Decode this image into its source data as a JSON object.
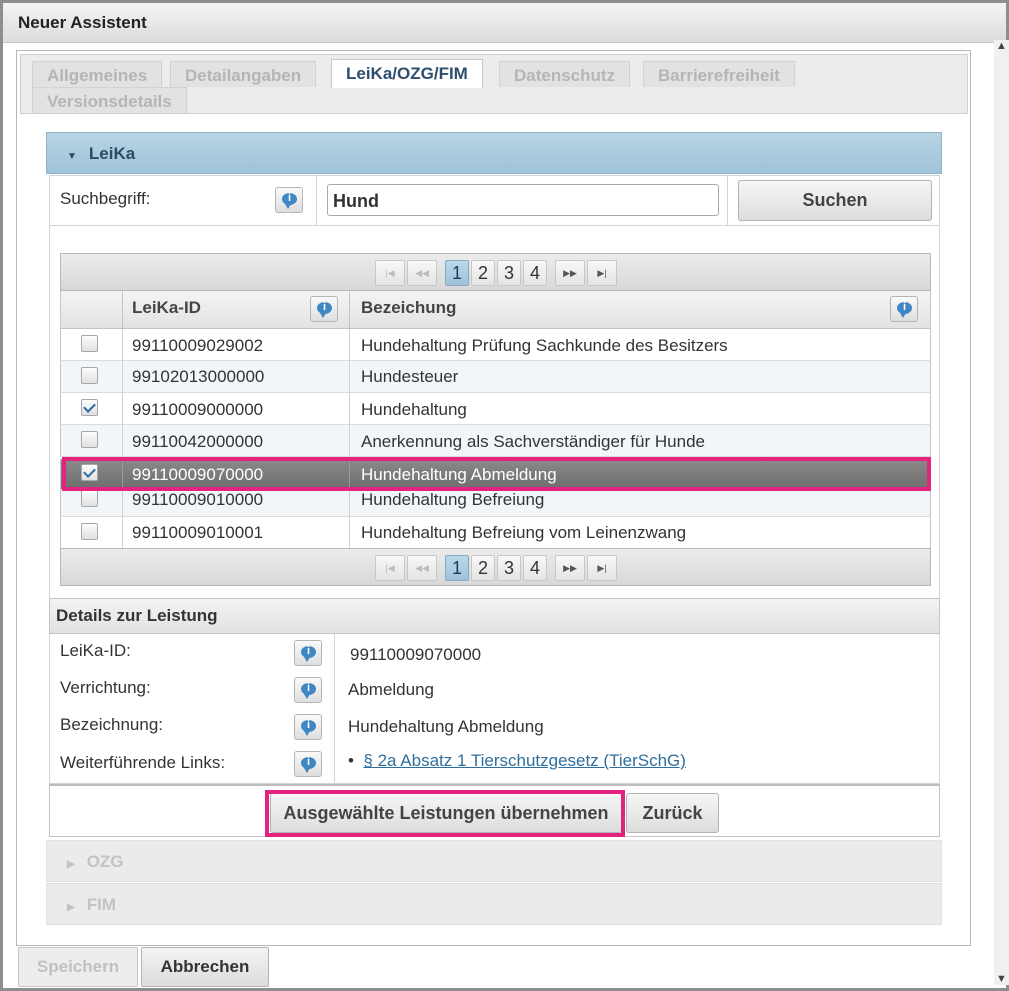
{
  "dialog": {
    "title": "Neuer Assistent"
  },
  "tabs": [
    {
      "label": "Allgemeines"
    },
    {
      "label": "Detailangaben"
    },
    {
      "label": "LeiKa/OZG/FIM"
    },
    {
      "label": "Datenschutz"
    },
    {
      "label": "Barrierefreiheit"
    },
    {
      "label": "Versionsdetails"
    }
  ],
  "active_tab": "LeiKa/OZG/FIM",
  "leika": {
    "header": "LeiKa",
    "search_label": "Suchbegriff:",
    "search_value": "Hund",
    "search_button": "Suchen",
    "pager": {
      "pages": [
        "1",
        "2",
        "3",
        "4"
      ],
      "current": "1",
      "first": "|◀",
      "prev": "◀◀",
      "next": "▶▶",
      "last": "▶|"
    },
    "columns": [
      "LeiKa-ID",
      "Bezeichung"
    ],
    "rows": [
      {
        "id": "99110009029002",
        "name": "Hundehaltung Prüfung Sachkunde des Besitzers",
        "checked": false
      },
      {
        "id": "99102013000000",
        "name": "Hundesteuer",
        "checked": false
      },
      {
        "id": "99110009000000",
        "name": "Hundehaltung",
        "checked": true
      },
      {
        "id": "99110042000000",
        "name": "Anerkennung als Sachverständiger für Hunde",
        "checked": false
      },
      {
        "id": "99110009070000",
        "name": "Hundehaltung Abmeldung",
        "checked": true,
        "selected": true
      },
      {
        "id": "99110009010000",
        "name": "Hundehaltung Befreiung",
        "checked": false
      },
      {
        "id": "99110009010001",
        "name": "Hundehaltung Befreiung vom Leinenzwang",
        "checked": false
      }
    ],
    "details": {
      "header": "Details zur Leistung",
      "leika_id_label": "LeiKa-ID:",
      "leika_id_value": "99110009070000",
      "verrichtung_label": "Verrichtung:",
      "verrichtung_value": "Abmeldung",
      "bezeichnung_label": "Bezeichnung:",
      "bezeichnung_value": "Hundehaltung Abmeldung",
      "links_label": "Weiterführende Links:",
      "link_text": "§ 2a Absatz 1 Tierschutzgesetz (TierSchG)"
    },
    "apply_button": "Ausgewählte Leistungen übernehmen",
    "back_button": "Zurück"
  },
  "accordion": {
    "ozg": "OZG",
    "fim": "FIM"
  },
  "footer": {
    "save": "Speichern",
    "cancel": "Abbrechen"
  },
  "colors": {
    "highlight": "#e3237f",
    "accent": "#9fc3d8",
    "selected_row": "#7a7a7a"
  },
  "icons": {
    "info": "info-bubble-icon",
    "expanded": "triangle-down-icon",
    "collapsed": "triangle-right-icon",
    "checkbox": "checkbox-icon"
  }
}
